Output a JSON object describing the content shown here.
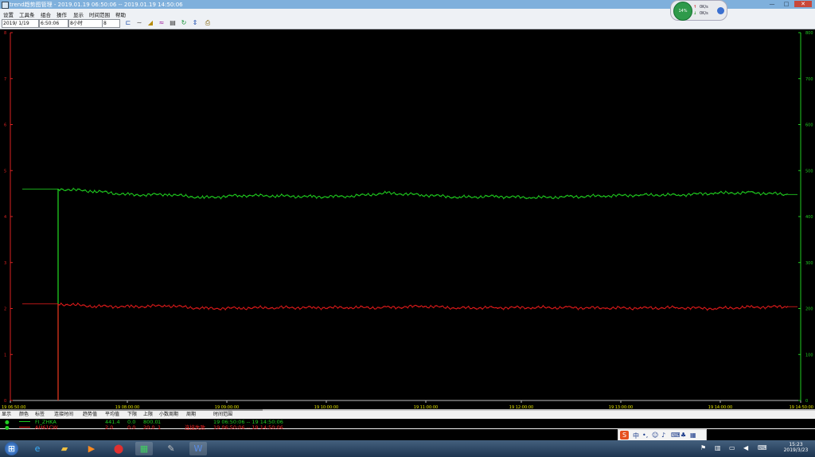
{
  "window": {
    "title": "trend趋势图管理 - 2019.01.19 06:50:06 -- 2019.01.19 14:50:06",
    "buttons": [
      "—",
      "□",
      "✕"
    ]
  },
  "menu": [
    "设置",
    "工具条",
    "组合",
    "操作",
    "显示",
    "时间范围",
    "帮助"
  ],
  "toolbar": {
    "date": "2019/ 1/19",
    "time": "6:50:06",
    "span": "8小时",
    "page": "8"
  },
  "gadget": {
    "value": "14%",
    "up_label": "↑",
    "up_value": "0K/s",
    "down_label": "↓",
    "down_value": "0K/s"
  },
  "colors": {
    "green_series": "#22dd22",
    "red_series": "#ee1c1c",
    "left_axis": "#dd2222",
    "right_axis": "#22cc22"
  },
  "chart_data": {
    "type": "line",
    "left_axis": {
      "ticks": [
        "8",
        "7",
        "6",
        "5",
        "4",
        "3",
        "2",
        "1",
        "0"
      ],
      "ylim": [
        0,
        8
      ]
    },
    "right_axis": {
      "ticks": [
        "800",
        "700",
        "600",
        "500",
        "400",
        "300",
        "200",
        "100",
        "0"
      ],
      "ylim": [
        0,
        800
      ]
    },
    "x_ticks": [
      "19 06:50:00",
      "19 08:00:00",
      "19 09:00:00",
      "19 10:00:00",
      "19 11:00:00",
      "19 12:00:00",
      "19 13:00:00",
      "19 14:00:00",
      "19 14:50:00"
    ],
    "series": [
      {
        "axis": "right",
        "color": "#22dd22",
        "x": [
          0,
          0.05,
          0.1,
          0.15,
          0.2,
          0.25,
          0.3,
          0.35,
          0.4,
          0.45,
          0.5,
          0.55,
          0.6,
          0.65,
          0.7,
          0.75,
          0.8,
          0.85,
          0.9,
          0.95,
          1
        ],
        "y": [
          460,
          455,
          447,
          448,
          441,
          446,
          445,
          443,
          444,
          451,
          447,
          442,
          444,
          441,
          443,
          445,
          447,
          447,
          451,
          452,
          448
        ]
      },
      {
        "axis": "left",
        "color": "#ee1c1c",
        "x": [
          0,
          0.05,
          0.1,
          0.15,
          0.2,
          0.25,
          0.3,
          0.35,
          0.4,
          0.45,
          0.5,
          0.55,
          0.6,
          0.65,
          0.7,
          0.75,
          0.8,
          0.85,
          0.9,
          0.95,
          1
        ],
        "y": [
          2.1,
          2.05,
          2.04,
          2.06,
          2.0,
          2.01,
          2.02,
          2.02,
          2.02,
          2.02,
          2.05,
          2.01,
          2.02,
          2.02,
          2.02,
          2.01,
          2.01,
          2.02,
          2.0,
          2.03,
          2.04
        ]
      }
    ]
  },
  "legend": {
    "headers": [
      "显示",
      "颜色",
      "标签",
      "连接时间",
      "趋势值",
      "平均值",
      "下限",
      "上限",
      "小数周期",
      "周期",
      "时间范围"
    ],
    "rows": [
      {
        "color": "#1ec81e",
        "tag": "FI_ZHKA",
        "value": "441.4",
        "avg": "0.0",
        "low": "800.0",
        "high": "1",
        "status": "",
        "range": "19 06:50:06 -- 19 14:50:06"
      },
      {
        "color": "#e01010",
        "tag": "AH61CW",
        "value": "2.0",
        "avg": "0.0",
        "low": "20.0",
        "high": "1",
        "status": "连接失败",
        "range": "19 06:50:06 -- 19 14:50:06"
      }
    ]
  },
  "ime": {
    "label": "中"
  },
  "taskbar": {
    "apps": [
      "start",
      "ie",
      "explorer",
      "media",
      "security",
      "trend",
      "paint",
      "word"
    ]
  },
  "clock": {
    "time": "15:23",
    "date": "2019/3/23"
  }
}
